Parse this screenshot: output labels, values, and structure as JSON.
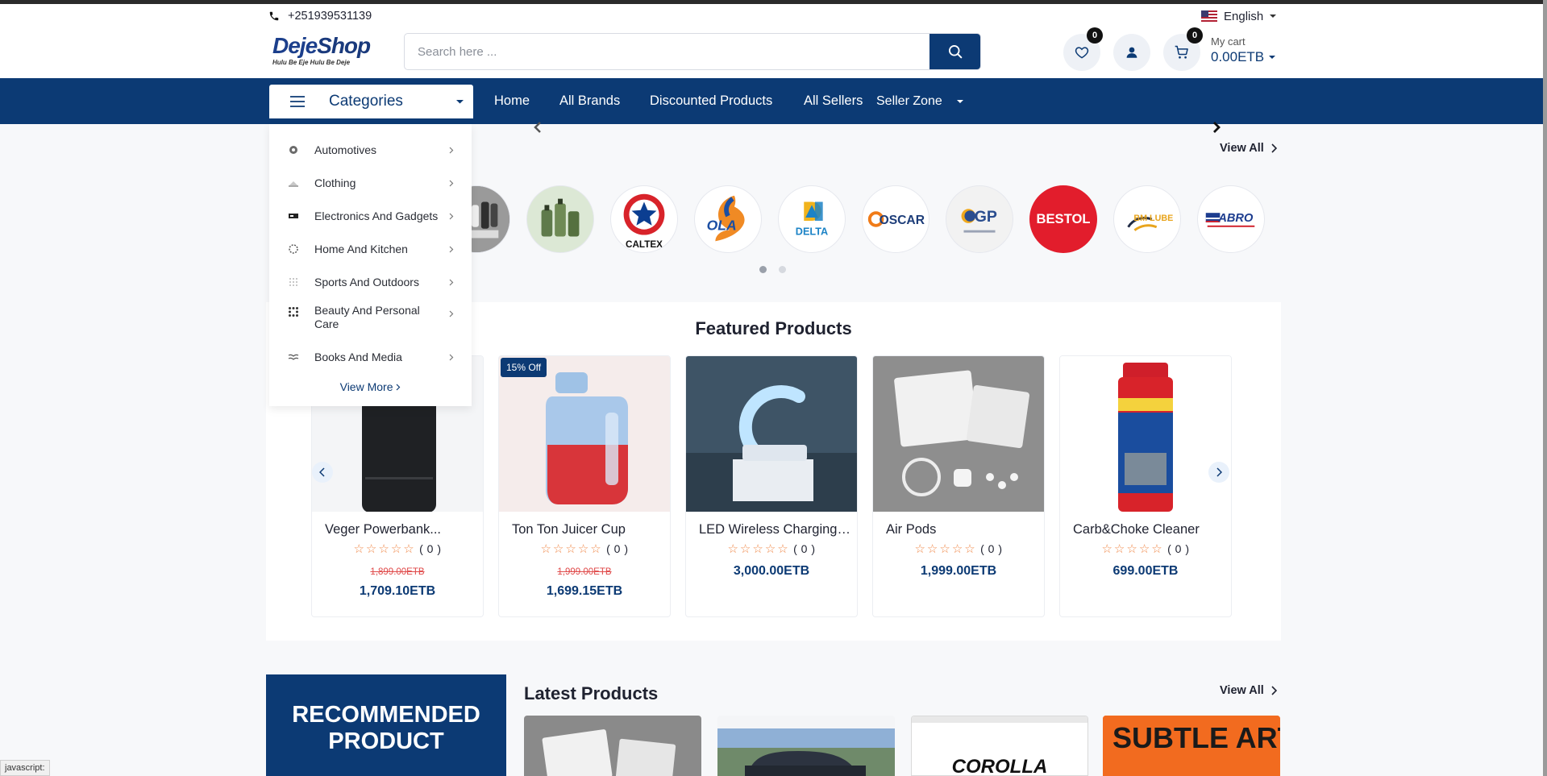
{
  "topbar": {
    "phone": "+251939531139",
    "language": "English"
  },
  "header": {
    "logo": {
      "name_part1": "Deje",
      "name_part2": "Shop",
      "tagline": "Hulu Be Eje Hulu Be Deje"
    },
    "search": {
      "placeholder": "Search here ...",
      "value": ""
    },
    "wishlist_count": "0",
    "cart_count": "0",
    "cart_label": "My cart",
    "cart_amount": "0.00ETB"
  },
  "nav": {
    "categories_label": "Categories",
    "links": [
      "Home",
      "All Brands",
      "Discounted Products",
      "All Sellers",
      "Seller Zone"
    ]
  },
  "categories": [
    {
      "label": "Automotives",
      "icon": "automotive-icon"
    },
    {
      "label": "Clothing",
      "icon": "clothing-icon"
    },
    {
      "label": "Electronics And Gadgets",
      "icon": "electronics-icon"
    },
    {
      "label": "Home And Kitchen",
      "icon": "home-kitchen-icon"
    },
    {
      "label": "Sports And Outdoors",
      "icon": "sports-icon"
    },
    {
      "label": "Beauty And Personal Care",
      "icon": "beauty-icon"
    },
    {
      "label": "Books And Media",
      "icon": "books-icon"
    }
  ],
  "categories_view_more": "View More",
  "brands": {
    "view_all": "View All",
    "logos": [
      {
        "name": "apparel-brand",
        "text": ""
      },
      {
        "name": "cosmetics-brand",
        "text": ""
      },
      {
        "name": "caltex-logo",
        "text": "CALTEX"
      },
      {
        "name": "ola-energy-logo",
        "text": "OLA"
      },
      {
        "name": "delta-logo",
        "text": "DELTA"
      },
      {
        "name": "oscar-logo",
        "text": "OSCAR"
      },
      {
        "name": "gp-logo",
        "text": "GP"
      },
      {
        "name": "bestol-logo",
        "text": "BESTOL"
      },
      {
        "name": "bm-lube-logo",
        "text": "BM LUBE"
      },
      {
        "name": "abro-logo",
        "text": "ABRO"
      }
    ]
  },
  "featured": {
    "title": "Featured Products",
    "products": [
      {
        "name": "Veger Powerbank...",
        "rating": "( 0 )",
        "old_price": "1,899.00ETB",
        "price": "1,709.10ETB",
        "badge": ""
      },
      {
        "name": "Ton Ton Juicer Cup",
        "rating": "( 0 )",
        "old_price": "1,999.00ETB",
        "price": "1,699.15ETB",
        "badge": "15% Off"
      },
      {
        "name": "LED Wireless Charging S...",
        "rating": "( 0 )",
        "old_price": "",
        "price": "3,000.00ETB",
        "badge": ""
      },
      {
        "name": "Air Pods",
        "rating": "( 0 )",
        "old_price": "",
        "price": "1,999.00ETB",
        "badge": ""
      },
      {
        "name": "Carb&Choke Cleaner",
        "rating": "( 0 )",
        "old_price": "",
        "price": "699.00ETB",
        "badge": ""
      }
    ]
  },
  "recommended": {
    "title": "RECOMMENDED PRODUCT"
  },
  "latest": {
    "title": "Latest Products",
    "view_all": "View All",
    "card_texts": [
      "",
      "",
      "COROLLA",
      "SUBTLE ART OF"
    ]
  },
  "status_bar": "javascript:",
  "colors": {
    "primary": "#0c3a74",
    "accent": "#f08a4b",
    "sale": "#e04b4b"
  }
}
